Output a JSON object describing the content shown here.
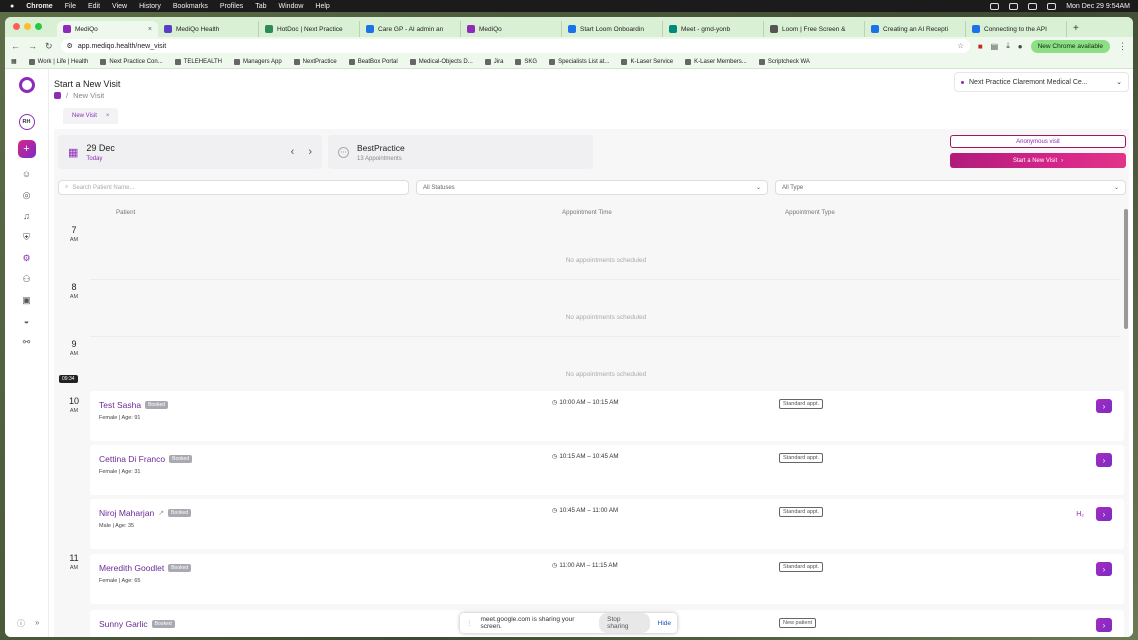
{
  "menubar": {
    "app": "Chrome",
    "items": [
      "File",
      "Edit",
      "View",
      "History",
      "Bookmarks",
      "Profiles",
      "Tab",
      "Window",
      "Help"
    ],
    "clock": "Mon Dec 29  9:54AM"
  },
  "tabs": [
    {
      "label": "MediQo",
      "color": "#8e2bb8",
      "active": true
    },
    {
      "label": "MediQo Health",
      "color": "#5b3cc4"
    },
    {
      "label": "HotDoc | Next Practice",
      "color": "#2e8b57"
    },
    {
      "label": "Care GP - AI admin an",
      "color": "#1a73e8"
    },
    {
      "label": "MediQo",
      "color": "#8e2bb8"
    },
    {
      "label": "Start Loom Onboardin",
      "color": "#1a73e8"
    },
    {
      "label": "Meet - gmd-yonb",
      "color": "#00897b"
    },
    {
      "label": "Loom | Free Screen &",
      "color": "#555"
    },
    {
      "label": "Creating an AI Recepti",
      "color": "#1a73e8"
    },
    {
      "label": "Connecting to the API",
      "color": "#1a73e8"
    }
  ],
  "address": {
    "url": "app.mediqo.health/new_visit",
    "new_chrome": "New Chrome available"
  },
  "bookmarks": [
    "Work | Life | Health",
    "Next Practice Con...",
    "TELEHEALTH",
    "Managers App",
    "NextPractice",
    "BeatBox Portal",
    "Medical-Objects D...",
    "Jira",
    "SKG",
    "Specialists List at...",
    "K-Laser Service",
    "K-Laser Members...",
    "Scriptcheck WA"
  ],
  "sidebar": {
    "avatar": "RH"
  },
  "header": {
    "title": "Start a New Visit",
    "breadcrumb": "New Visit",
    "practice": "Next Practice Claremont Medical Ce..."
  },
  "visit_tab": {
    "label": "New Visit"
  },
  "date_card": {
    "date": "29 Dec",
    "sub": "Today"
  },
  "bp_card": {
    "title": "BestPractice",
    "sub": "13 Appointments"
  },
  "buttons": {
    "anonymous": "Anonymous visit",
    "start": "Start a New Visit"
  },
  "filters": {
    "search_placeholder": "Search Patient Name...",
    "status": "All Statuses",
    "type": "All Type"
  },
  "columns": {
    "patient": "Patient",
    "time": "Appointment Time",
    "type": "Appointment Type"
  },
  "hours": [
    {
      "h": "7",
      "ap": "AM"
    },
    {
      "h": "8",
      "ap": "AM"
    },
    {
      "h": "9",
      "ap": "AM"
    },
    {
      "h": "10",
      "ap": "AM"
    },
    {
      "h": "11",
      "ap": "AM"
    }
  ],
  "empty_text": "No appointments scheduled",
  "now_marker": "09:34",
  "appointments": [
    {
      "name": "Test Sasha",
      "badge": "Booked",
      "meta": "Female | Age: 91",
      "time": "10:00 AM – 10:15 AM",
      "type": "Standard appt."
    },
    {
      "name": "Cettina Di Franco",
      "badge": "Booked",
      "meta": "Female | Age: 31",
      "time": "10:15 AM – 10:45 AM",
      "type": "Standard appt."
    },
    {
      "name": "Niroj Maharjan",
      "badge": "Booked",
      "meta": "Male | Age: 35",
      "time": "10:45 AM – 11:00 AM",
      "type": "Standard appt.",
      "extra": "H₂"
    },
    {
      "name": "Meredith Goodlet",
      "badge": "Booked",
      "meta": "Female | Age: 65",
      "time": "11:00 AM – 11:15 AM",
      "type": "Standard appt."
    },
    {
      "name": "Sunny Garlic",
      "badge": "Booked",
      "meta": "",
      "time": "",
      "type": "New patient"
    }
  ],
  "share_bar": {
    "text": "meet.google.com is sharing your screen.",
    "stop": "Stop sharing",
    "hide": "Hide"
  }
}
